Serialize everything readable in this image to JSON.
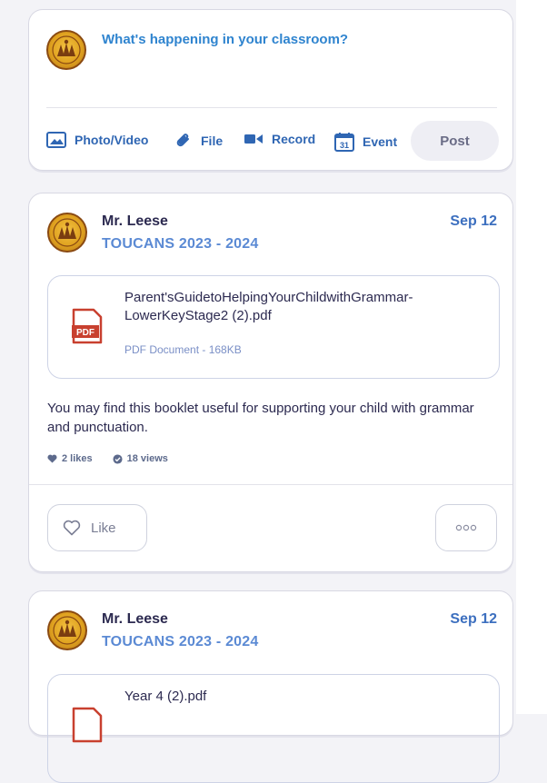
{
  "composer": {
    "prompt": "What's happening in your classroom?",
    "tools": [
      {
        "label": "Photo/Video",
        "icon": "image-icon"
      },
      {
        "label": "File",
        "icon": "paperclip-icon"
      },
      {
        "label": "Record",
        "icon": "video-camera-icon"
      },
      {
        "label": "Event",
        "icon": "calendar-icon",
        "icon_text": "31"
      }
    ],
    "post_label": "Post"
  },
  "posts": [
    {
      "author": "Mr. Leese",
      "class_name": "TOUCANS 2023 - 2024",
      "date": "Sep 12",
      "attachment": {
        "name": "Parent'sGuidetoHelpingYourChildwithGrammar-LowerKeyStage2 (2).pdf",
        "meta": "PDF Document - 168KB",
        "icon_text": "PDF"
      },
      "text": "You may find this booklet useful for supporting your child with grammar and punctuation.",
      "likes": "2 likes",
      "views": "18 views",
      "like_label": "Like"
    },
    {
      "author": "Mr. Leese",
      "class_name": "TOUCANS 2023 - 2024",
      "date": "Sep 12",
      "attachment": {
        "name": "Year 4 (2).pdf"
      }
    }
  ],
  "colors": {
    "accent_blue": "#2f84cf",
    "tool_blue": "#2f66b3",
    "class_blue": "#5b8ad4",
    "pdf_red": "#c8402f",
    "crest_gold": "#e0a21f"
  }
}
